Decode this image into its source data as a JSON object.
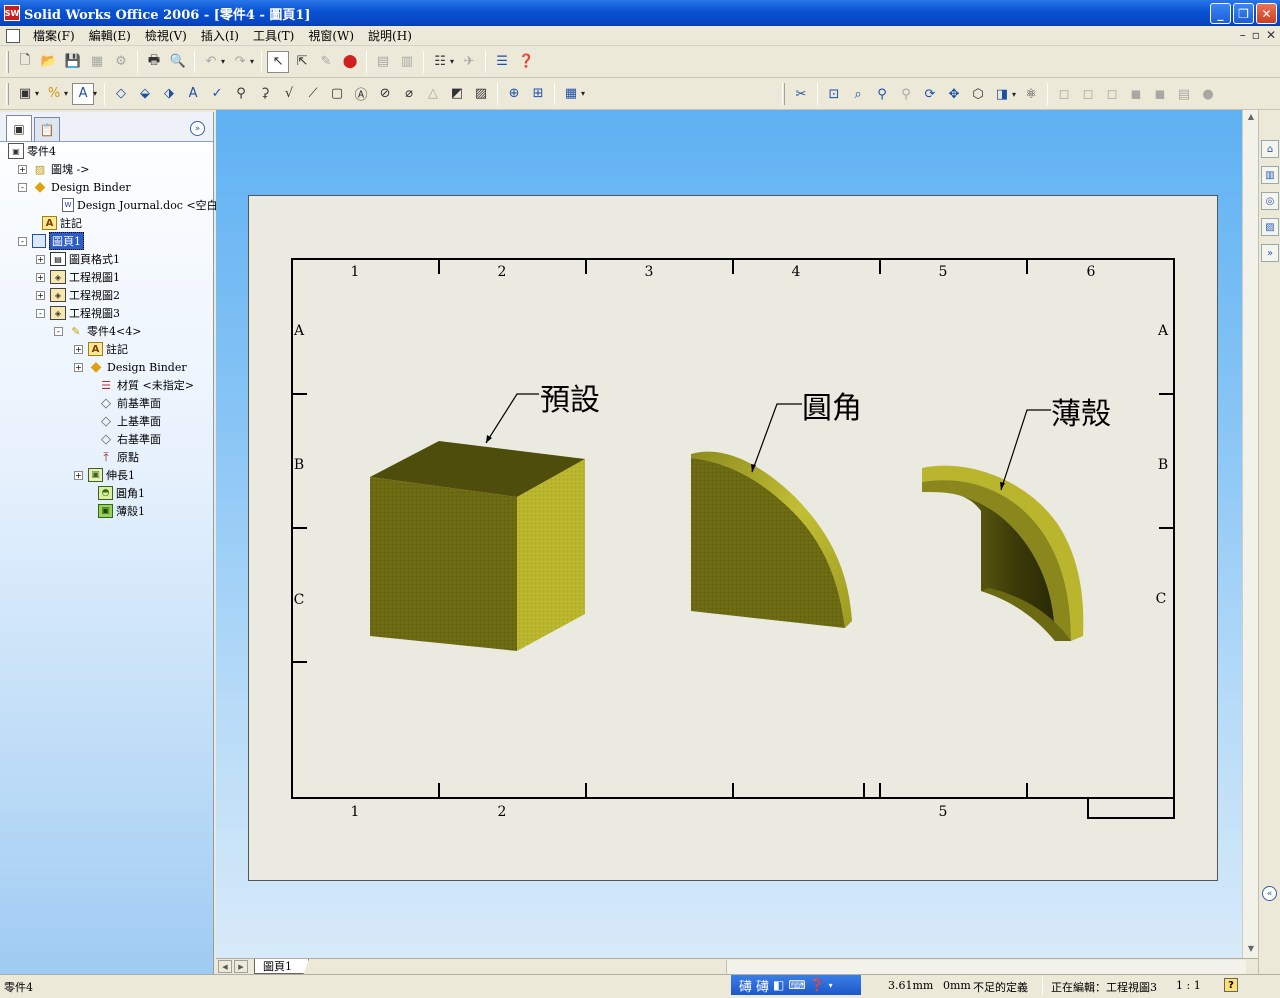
{
  "window": {
    "title": "Solid Works Office 2006 - [零件4 - 圖頁1]",
    "app_icon": "SW"
  },
  "menu": {
    "items": [
      "檔案(F)",
      "編輯(E)",
      "檢視(V)",
      "插入(I)",
      "工具(T)",
      "視窗(W)",
      "說明(H)"
    ]
  },
  "tree": {
    "items": [
      {
        "label": "零件4",
        "icon": "part-icon",
        "toggle": ""
      },
      {
        "label": "圖塊 ->",
        "icon": "blocks-folder-icon",
        "toggle": "+"
      },
      {
        "label": "Design Binder",
        "icon": "design-binder-icon",
        "toggle": "-"
      },
      {
        "label": "Design Journal.doc <空白>",
        "icon": "word-document-icon",
        "toggle": ""
      },
      {
        "label": "註記",
        "icon": "annotations-icon",
        "toggle": ""
      },
      {
        "label": "圖頁1",
        "icon": "sheet-icon",
        "toggle": "-",
        "selected": true
      },
      {
        "label": "圖頁格式1",
        "icon": "sheet-format-icon",
        "toggle": "+"
      },
      {
        "label": "工程視圖1",
        "icon": "drawing-view-icon",
        "toggle": "+"
      },
      {
        "label": "工程視圖2",
        "icon": "drawing-view-icon",
        "toggle": "+"
      },
      {
        "label": "工程視圖3",
        "icon": "drawing-view-icon",
        "toggle": "-"
      },
      {
        "label": "零件4<4>",
        "icon": "part-reference-icon",
        "toggle": "-"
      },
      {
        "label": "註記",
        "icon": "annotations-icon",
        "toggle": "+"
      },
      {
        "label": "Design Binder",
        "icon": "design-binder-icon",
        "toggle": "+"
      },
      {
        "label": "材質 <未指定>",
        "icon": "material-icon",
        "toggle": ""
      },
      {
        "label": "前基準面",
        "icon": "plane-icon",
        "toggle": ""
      },
      {
        "label": "上基準面",
        "icon": "plane-icon",
        "toggle": ""
      },
      {
        "label": "右基準面",
        "icon": "plane-icon",
        "toggle": ""
      },
      {
        "label": "原點",
        "icon": "origin-icon",
        "toggle": ""
      },
      {
        "label": "伸長1",
        "icon": "extrude-feature-icon",
        "toggle": "+"
      },
      {
        "label": "圓角1",
        "icon": "fillet-feature-icon",
        "toggle": ""
      },
      {
        "label": "薄殼1",
        "icon": "shell-feature-icon",
        "toggle": ""
      }
    ]
  },
  "drawing": {
    "top_zone_labels": [
      "1",
      "2",
      "3",
      "4",
      "5",
      "6"
    ],
    "bottom_zone_labels": [
      "1",
      "2",
      "5"
    ],
    "row_labels": [
      "A",
      "B",
      "C"
    ],
    "callouts": {
      "default": "預設",
      "fillet": "圓角",
      "shell": "薄殼"
    },
    "colors": {
      "model_front": "#6b6a12",
      "model_top": "#4f4d0c",
      "model_side": "#b9b62e",
      "sheet": "#ebeae1"
    }
  },
  "sheet_tabs": {
    "active": "圖頁1"
  },
  "status": {
    "left": "零件4",
    "coord": "3.61mm",
    "z": "0mm",
    "definition": "不足的定義",
    "editing": "正在編輯：工程視圖3",
    "scale": "1 : 1",
    "ime": [
      "礡",
      "礡"
    ]
  }
}
